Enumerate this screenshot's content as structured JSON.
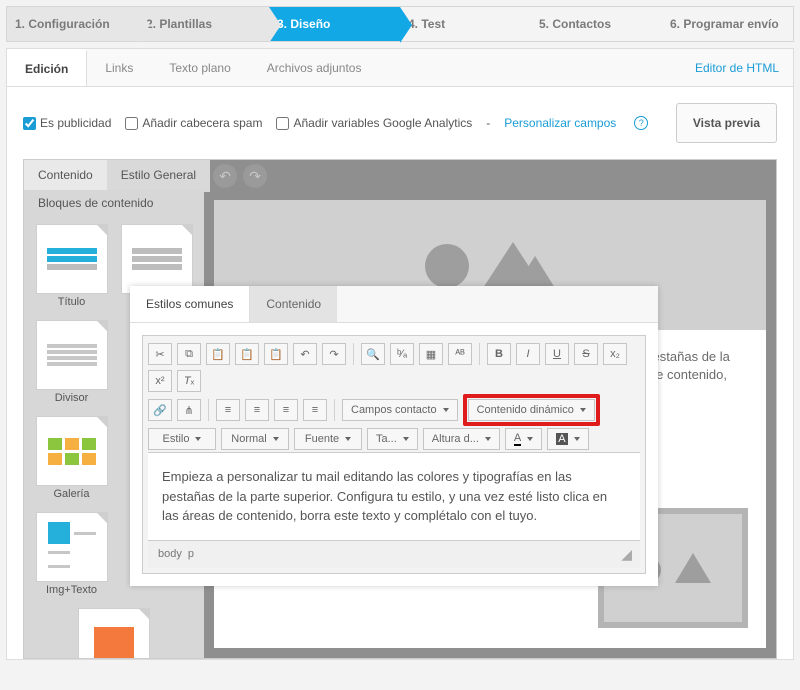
{
  "wizard": {
    "steps": [
      "1. Configuración",
      "2. Plantillas",
      "3. Diseño",
      "4. Test",
      "5. Contactos",
      "6. Programar envío"
    ]
  },
  "tabs": {
    "edit": "Edición",
    "links": "Links",
    "plain": "Texto plano",
    "attach": "Archivos adjuntos",
    "html_editor": "Editor de HTML"
  },
  "options": {
    "ad": "Es publicidad",
    "spam": "Añadir cabecera spam",
    "ga": "Añadir variables Google Analytics",
    "personalize_sep": " - ",
    "personalize": "Personalizar campos"
  },
  "preview_btn": "Vista previa",
  "builder": {
    "tab_content": "Contenido",
    "tab_style": "Estilo General",
    "blocks_header": "Bloques de contenido",
    "blocks": {
      "title": "Título",
      "divider": "Divisor",
      "gallery": "Galería",
      "imgtext": "Img+Texto"
    },
    "canvas_text": "Empieza a personalizar tu mail editando las colores y tipografías en las pestañas de la parte superior. Configura tu estilo, y una vez esté listo clica en las áreas de contenido, borra este texto y complétalo con el tuyo."
  },
  "modal": {
    "tab_common": "Estilos comunes",
    "tab_content": "Contenido",
    "dropdowns": {
      "contact_fields": "Campos contacto",
      "dynamic_content": "Contenido dinámico",
      "style": "Estilo",
      "paragraph": "Normal",
      "font": "Fuente",
      "size": "Ta...",
      "lineheight": "Altura d...",
      "fontcolor": "A",
      "bgcolor": "A"
    },
    "body_path": [
      "body",
      "p"
    ],
    "content": "Empieza a personalizar tu mail editando las colores y tipografías en las pestañas de la parte superior. Configura tu estilo, y una vez esté listo clica en las áreas de contenido, borra este texto y complétalo con el tuyo."
  }
}
